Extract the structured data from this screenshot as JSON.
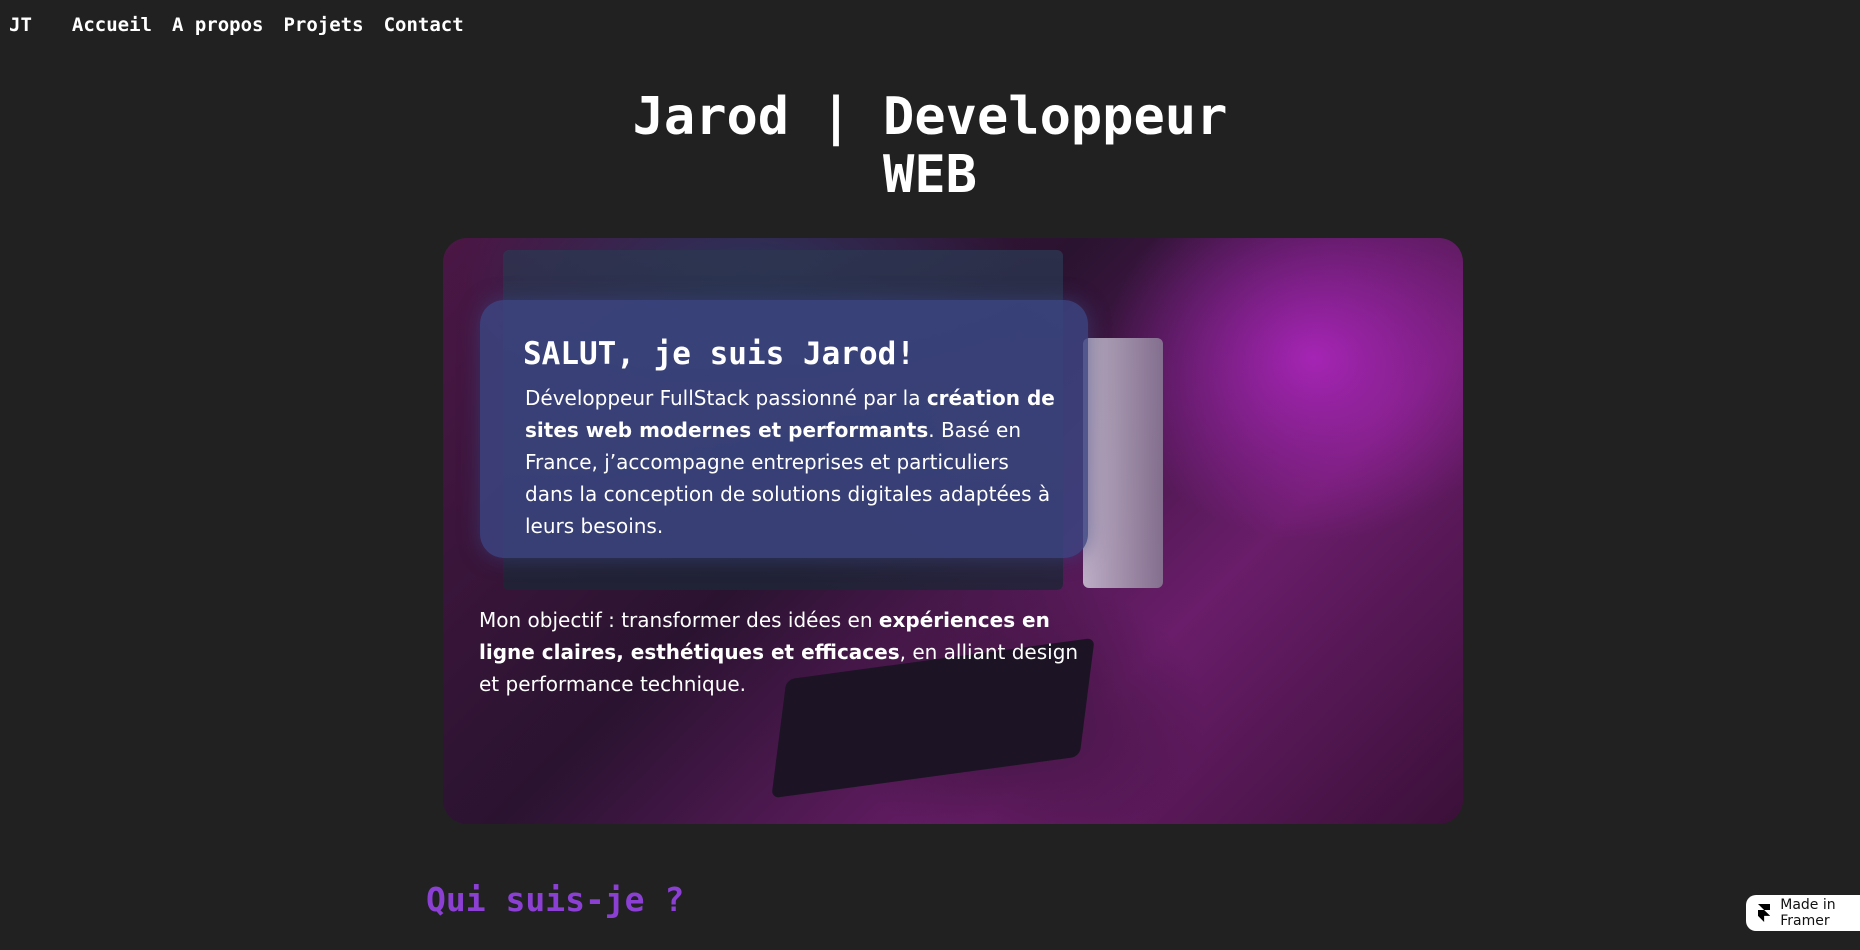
{
  "nav": {
    "logo": "JT",
    "links": [
      "Accueil",
      "A propos",
      "Projets",
      "Contact"
    ]
  },
  "hero": {
    "title_line1": "Jarod | Developpeur",
    "title_line2": "WEB"
  },
  "card": {
    "heading": "SALUT, je suis Jarod!",
    "intro": {
      "t1": "Développeur FullStack passionné par la ",
      "b1": "création de sites web modernes et performants",
      "t2": ". Basé en France, j’accompagne entreprises et particuliers dans la conception de solutions digitales adaptées à leurs besoins."
    },
    "objective": {
      "t1": "Mon objectif : transformer des idées en ",
      "b1": "expériences en ligne claires, esthétiques et efficaces",
      "t2": ", en alliant design et performance technique."
    }
  },
  "section": {
    "title": "Qui suis-je ?"
  },
  "badge": {
    "label": "Made in Framer"
  }
}
